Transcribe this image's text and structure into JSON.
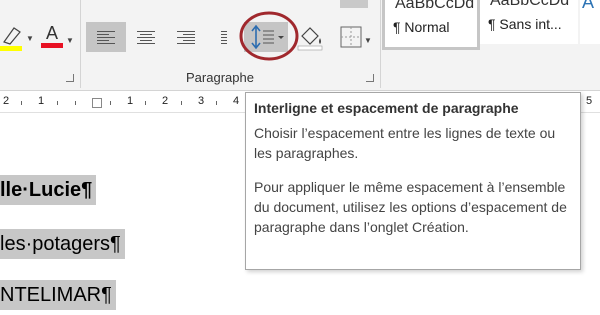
{
  "ribbon": {
    "group_label": "Paragraphe",
    "highlight_color": "#ffff00",
    "font_color": "#e81123",
    "styles": [
      {
        "preview": "AaBbCcDd",
        "name": "¶ Normal",
        "active": true
      },
      {
        "preview": "AaBbCcDd",
        "name": "¶ Sans int...",
        "active": false
      },
      {
        "preview": "A",
        "name": "",
        "active": false
      }
    ],
    "annotation_color": "#a0282d"
  },
  "ruler": {
    "numbers": [
      "2",
      "1",
      "1",
      "2",
      "3",
      "4",
      "5"
    ]
  },
  "document": {
    "lines": [
      "lle·Lucie¶",
      "les·potagers¶",
      "NTELIMAR¶"
    ],
    "selection_color": "#c7c7c7"
  },
  "tooltip": {
    "title": "Interligne et espacement de paragraphe",
    "description": "Choisir l’espacement entre les lignes de texte ou les paragraphes.",
    "detail": "Pour appliquer le même espacement à l’ensemble du document, utilisez les options d’espacement de paragraphe dans l’onglet Création."
  }
}
